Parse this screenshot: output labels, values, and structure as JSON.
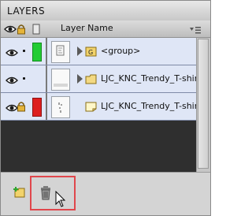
{
  "panel": {
    "title": "LAYERS",
    "column_header": "Layer Name"
  },
  "layers": [
    {
      "name": "<group>",
      "color": "#22cc33",
      "locked": false,
      "type": "group"
    },
    {
      "name": "LJC_KNC_Trendy_T-shir",
      "color": "",
      "locked": false,
      "type": "folder"
    },
    {
      "name": "LJC_KNC_Trendy_T-shir",
      "color": "#dd1f1f",
      "locked": true,
      "type": "layer"
    }
  ],
  "colors": {
    "row_background": "#dfe6f6",
    "empty_area": "#2f2f2f",
    "highlight_box": "#e0474c"
  }
}
